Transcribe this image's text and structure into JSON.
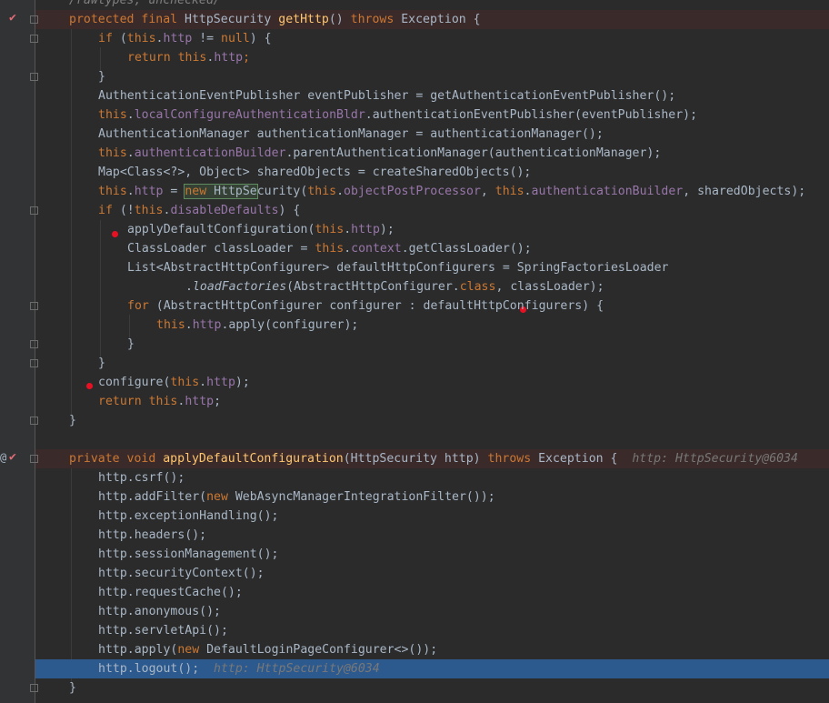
{
  "editor": {
    "comment": "/rawtypes, unchecked/",
    "m1_sig_kw": "protected final",
    "m1_sig_type": " HttpSecurity ",
    "m1_sig_name": "getHttp",
    "m1_sig_throws": "throws",
    "m1_sig_exc": " Exception {",
    "l3_if": "if",
    "l3_rest1": " (",
    "l3_this": "this",
    "l3_rest2": ".",
    "l3_http": "http",
    "l3_rest3": " != ",
    "l3_null": "null",
    "l3_rest4": ") {",
    "l4_return": "return",
    "l4_sp": " ",
    "l4_this": "this",
    "l4_dot": ".",
    "l4_http": "http",
    "l4_semi": ";",
    "l5": "}",
    "l6": "AuthenticationEventPublisher eventPublisher = getAuthenticationEventPublisher();",
    "l7_this": "this",
    "l7_dot": ".",
    "l7_field": "localConfigureAuthenticationBldr",
    "l7_rest": ".authenticationEventPublisher(eventPublisher);",
    "l8": "AuthenticationManager authenticationManager = authenticationManager();",
    "l9_this": "this",
    "l9_dot": ".",
    "l9_field": "authenticationBuilder",
    "l9_rest": ".parentAuthenticationManager(authenticationManager);",
    "l10": "Map<Class<?>, Object> sharedObjects = createSharedObjects();",
    "l11_this": "this",
    "l11_dot": ".",
    "l11_http": "http",
    "l11_eq": " = ",
    "l11_new": "new",
    "l11_sp": " ",
    "l11_cls_hl": "HttpSe",
    "l11_cls_rest": "curity(",
    "l11_this2": "this",
    "l11_dot2": ".",
    "l11_opp": "objectPostProcessor",
    "l11_comma": ", ",
    "l11_this3": "this",
    "l11_dot3": ".",
    "l11_ab": "authenticationBuilder",
    "l11_end": ", sharedObjects);",
    "l12_if": "if",
    "l12_a": " (!",
    "l12_this": "this",
    "l12_dot": ".",
    "l12_dd": "disableDefaults",
    "l12_b": ") {",
    "l13_a": "applyDefaultConfiguration(",
    "l13_this": "this",
    "l13_dot": ".",
    "l13_http": "http",
    "l13_b": ");",
    "l14_a": "ClassLoader classLoader = ",
    "l14_this": "this",
    "l14_dot": ".",
    "l14_ctx": "context",
    "l14_b": ".getClassLoader();",
    "l15": "List<AbstractHttpConfigurer> defaultHttpConfigurers = SpringFactoriesLoader",
    "l16_a": ".",
    "l16_lf": "loadFactories",
    "l16_b": "(AbstractHttpConfigurer.",
    "l16_class": "class",
    "l16_c": ", classLoader);",
    "l17_for": "for",
    "l17_a": " (AbstractHttpConfigurer configurer : defaultHttpConfigurers) {",
    "l18_this": "this",
    "l18_dot": ".",
    "l18_http": "http",
    "l18_b": ".apply(configurer);",
    "l19": "}",
    "l20": "}",
    "l21_a": "configure(",
    "l21_this": "this",
    "l21_dot": ".",
    "l21_http": "http",
    "l21_b": ");",
    "l22_ret": "return",
    "l22_sp": " ",
    "l22_this": "this",
    "l22_dot": ".",
    "l22_http": "http",
    "l22_b": ";",
    "l23": "}",
    "m2_kw": "private void",
    "m2_sp": " ",
    "m2_name": "applyDefaultConfiguration",
    "m2_params": "(HttpSecurity http) ",
    "m2_throws": "throws",
    "m2_exc": " Exception {",
    "m2_hint": "http: HttpSecurity@6034",
    "s1": "http.csrf();",
    "s2_a": "http.addFilter(",
    "s2_new": "new",
    "s2_b": " WebAsyncManagerIntegrationFilter());",
    "s3": "http.exceptionHandling();",
    "s4": "http.headers();",
    "s5": "http.sessionManagement();",
    "s6": "http.securityContext();",
    "s7": "http.requestCache();",
    "s8": "http.anonymous();",
    "s9": "http.servletApi();",
    "s10_a": "http.apply(",
    "s10_new": "new",
    "s10_b": " DefaultLoginPageConfigurer<>());",
    "s11": "http.logout();",
    "s11_hint": "http: HttpSecurity@6034",
    "s12": "}"
  },
  "icons": {
    "breakpoint": "method-breakpoint-icon",
    "annotation": "at-icon",
    "fold": "fold-marker-icon",
    "dot": "breakpoint-dot-icon"
  },
  "colors": {
    "background": "#2b2b2b",
    "keyword": "#cc7832",
    "method": "#ffc66d",
    "field": "#9876aa",
    "text": "#a9b7c6",
    "execution_line": "#2d5a8e",
    "breakpoint": "#e81123"
  }
}
